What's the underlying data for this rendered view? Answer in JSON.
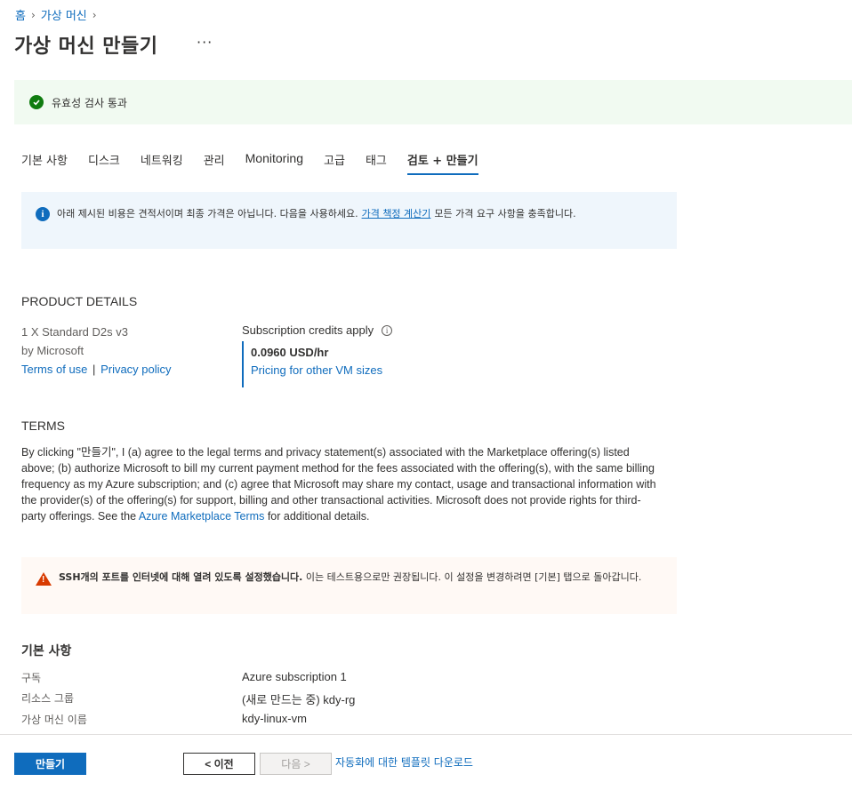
{
  "breadcrumb": {
    "home": "홈",
    "parent": "가상 머신"
  },
  "header": {
    "title": "가상 머신 만들기",
    "more": "···"
  },
  "validation": {
    "text": "유효성 검사 통과"
  },
  "tabs": [
    {
      "label": "기본 사항"
    },
    {
      "label": "디스크"
    },
    {
      "label": "네트워킹"
    },
    {
      "label": "관리"
    },
    {
      "label": "Monitoring"
    },
    {
      "label": "고급"
    },
    {
      "label": "태그"
    },
    {
      "label": "검토 + 만들기"
    }
  ],
  "info_banner": {
    "text_before": "아래 제시된 비용은 견적서이며 최종 가격은 아닙니다. 다음을 사용하세요.",
    "link": "가격 책정 계산기",
    "text_after": "모든 가격 요구 사항을 충족합니다."
  },
  "product": {
    "heading": "PRODUCT DETAILS",
    "name": "1 X Standard D2s v3",
    "publisher": "by Microsoft",
    "terms_link": "Terms of use",
    "separator": "|",
    "privacy_link": "Privacy policy",
    "credits_label": "Subscription credits apply",
    "price": "0.0960 USD/hr",
    "pricing_link": "Pricing for other VM sizes"
  },
  "terms": {
    "heading": "TERMS",
    "text_before": "By clicking \"만들기\", I (a) agree to the legal terms and privacy statement(s) associated with the Marketplace offering(s) listed above; (b) authorize Microsoft to bill my current payment method for the fees associated with the offering(s), with the same billing frequency as my Azure subscription; and (c) agree that Microsoft may share my contact, usage and transactional information with the provider(s) of the offering(s) for support, billing and other transactional activities. Microsoft does not provide rights for third-party offerings. See the",
    "link": "Azure Marketplace Terms",
    "text_after": "for additional details."
  },
  "warning": {
    "bold": "SSH개의 포트를 인터넷에 대해 열려 있도록 설정했습니다.",
    "text": "이는 테스트용으로만 권장됩니다.  이 설정을 변경하려면 [기본] 탭으로 돌아갑니다."
  },
  "basics": {
    "heading": "기본 사항",
    "rows": [
      {
        "label": "구독",
        "value": "Azure subscription 1"
      },
      {
        "label": "리소스 그룹",
        "value": "(새로 만드는 중) kdy-rg"
      },
      {
        "label": "가상 머신 이름",
        "value": "kdy-linux-vm"
      }
    ]
  },
  "footer": {
    "create": "만들기",
    "prev": "< 이전",
    "next": "다음 >",
    "template_link": "자동화에 대한 템플릿 다운로드"
  }
}
